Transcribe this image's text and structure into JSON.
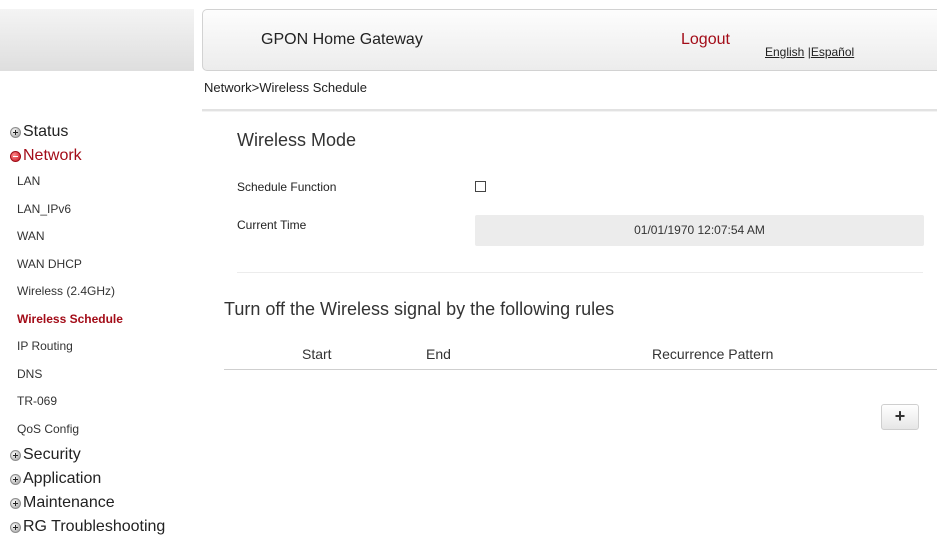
{
  "header": {
    "title": "GPON Home Gateway",
    "logout": "Logout",
    "lang_english": "English",
    "lang_separator": " |",
    "lang_spanish": "Español"
  },
  "breadcrumb": "Network>Wireless Schedule",
  "sidebar": {
    "status": "Status",
    "network": "Network",
    "network_items": [
      "LAN",
      "LAN_IPv6",
      "WAN",
      "WAN DHCP",
      "Wireless (2.4GHz)",
      "Wireless Schedule",
      "IP Routing",
      "DNS",
      "TR-069",
      "QoS Config"
    ],
    "active_item": "Wireless Schedule",
    "security": "Security",
    "application": "Application",
    "maintenance": "Maintenance",
    "rg_troubleshooting": "RG Troubleshooting"
  },
  "main": {
    "section_title": "Wireless Mode",
    "schedule_function_label": "Schedule Function",
    "schedule_function_checked": false,
    "current_time_label": "Current Time",
    "current_time_value": "01/01/1970 12:07:54 AM",
    "rules_title": "Turn off the Wireless signal by the following rules",
    "table_headers": {
      "start": "Start",
      "end": "End",
      "recurrence": "Recurrence Pattern"
    },
    "add_button": "+"
  },
  "colors": {
    "accent": "#a30c18",
    "time_box_bg": "#ececec"
  }
}
